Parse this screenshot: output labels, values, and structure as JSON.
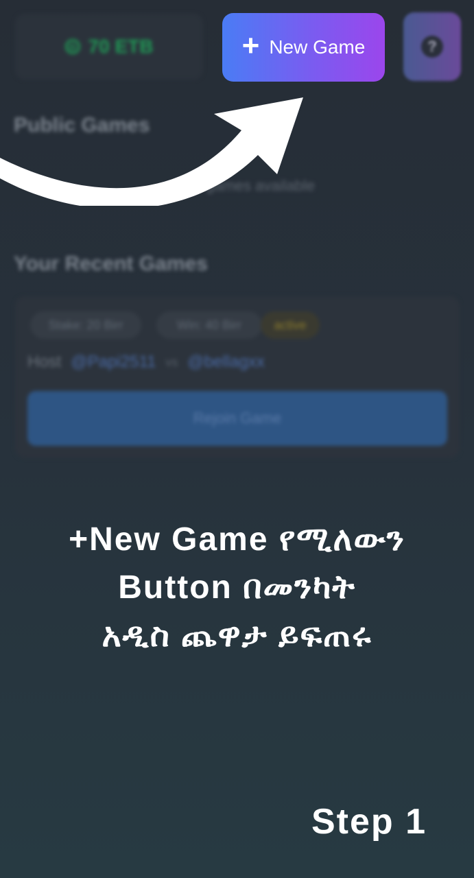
{
  "balance": {
    "amount": "70 ETB",
    "icon": "coin-icon"
  },
  "new_game": {
    "label": "New Game",
    "icon": "plus-icon"
  },
  "help": {
    "icon_glyph": "?"
  },
  "public_games": {
    "title": "Public Games",
    "empty_text": "games available"
  },
  "recent_games": {
    "title": "Your Recent Games",
    "stake": "Stake: 20 Birr",
    "win": "Win: 40 Birr",
    "status": "active",
    "host_label": "Host",
    "host_user": "@Papi2511",
    "vs": "vs",
    "opponent_user": "@bellagxx",
    "rejoin_label": "Rejoin Game"
  },
  "overlay": {
    "line1": "+New Game የሚለውን",
    "line2": "Button በመንካት",
    "line3": "አዲስ ጨዋታ ይፍጠሩ",
    "step": "Step 1"
  },
  "colors": {
    "accent_start": "#4a7cf5",
    "accent_end": "#9b46ec",
    "balance_green": "#1f9a55",
    "rejoin_blue": "#2e5584"
  }
}
